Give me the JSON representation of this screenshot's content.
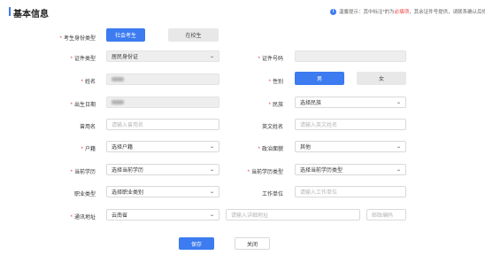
{
  "header": {
    "title": "基本信息",
    "notice_pre": "温馨提示：其中标注*的为",
    "notice_red": "必填项",
    "notice_post": "，其余证件号提供，请联系确认后修改"
  },
  "fields": {
    "candidate_type": {
      "label": "考生身份类型",
      "required": true,
      "options": [
        "社会考生",
        "在校生"
      ],
      "selected": "社会考生"
    },
    "id_type": {
      "label": "证件类型",
      "required": true,
      "value": "居民身份证"
    },
    "id_number": {
      "label": "证件号码",
      "required": true,
      "value": ""
    },
    "name": {
      "label": "姓名",
      "required": true,
      "value": ""
    },
    "gender": {
      "label": "性别",
      "required": true,
      "options": [
        "男",
        "女"
      ],
      "selected": "男"
    },
    "birth_date": {
      "label": "出生日期",
      "required": true,
      "value": ""
    },
    "ethnicity": {
      "label": "民族",
      "required": true,
      "placeholder": "选择民族"
    },
    "former_name": {
      "label": "曾用名",
      "required": false,
      "placeholder": "请输入曾用名"
    },
    "english_name": {
      "label": "英文姓名",
      "required": false,
      "placeholder": "请输入英文姓名"
    },
    "household": {
      "label": "户籍",
      "required": true,
      "placeholder": "选择户籍"
    },
    "political_status": {
      "label": "政治面貌",
      "required": true,
      "value": "其他"
    },
    "education": {
      "label": "当前学历",
      "required": true,
      "placeholder": "选择当前学历"
    },
    "education_type": {
      "label": "当前学历类型",
      "required": true,
      "placeholder": "选择当前学历类型"
    },
    "occupation": {
      "label": "职业类型",
      "required": false,
      "placeholder": "选择职业类别"
    },
    "employer": {
      "label": "工作单位",
      "required": false,
      "placeholder": "请输入工作单位"
    },
    "address": {
      "label": "通讯地址",
      "required": true,
      "province": "云南省",
      "detail_placeholder": "请输入详细地址",
      "postcode_placeholder": "邮政编码"
    }
  },
  "actions": {
    "save": "保存",
    "close": "关闭"
  },
  "colors": {
    "accent": "#3c7bf0",
    "required": "#e33333",
    "disabled_bg": "#eeeeee"
  },
  "icons": {
    "info": "info-icon",
    "dropdown": "chevron-down-icon"
  }
}
